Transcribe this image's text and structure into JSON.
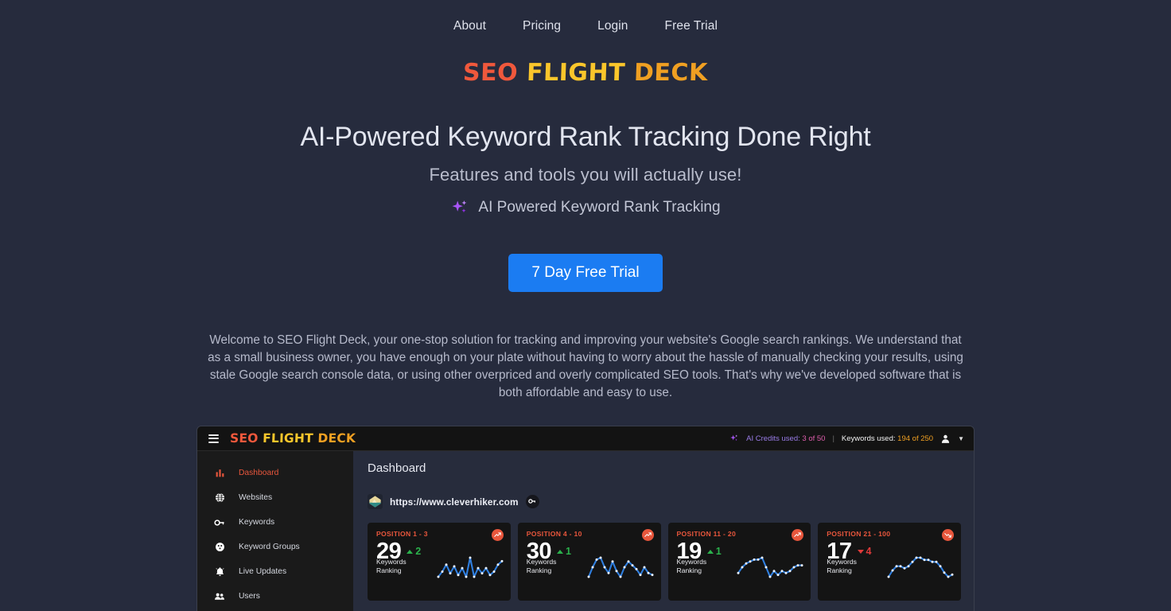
{
  "nav": {
    "items": [
      {
        "label": "About"
      },
      {
        "label": "Pricing"
      },
      {
        "label": "Login"
      },
      {
        "label": "Free Trial"
      }
    ]
  },
  "logo": {
    "part1": "SEO",
    "part2": "FLIGHT",
    "part3": "DECK",
    "color1": "#f0583c",
    "color2": "#fac62b",
    "color3": "#f0a022"
  },
  "hero": {
    "headline": "AI-Powered Keyword Rank Tracking Done Right",
    "subheadline": "Features and tools you will actually use!",
    "feature_line": "AI Powered Keyword Rank Tracking",
    "feature_icon": "sparkle-icon",
    "cta_label": "7 Day Free Trial",
    "cta_color": "#1b7cf2"
  },
  "intro": {
    "paragraph": "Welcome to SEO Flight Deck, your one-stop solution for tracking and improving your website's Google search rankings. We understand that as a small business owner, you have enough on your plate without having to worry about the hassle of manually checking your results, using stale Google search console data, or using other overpriced and overly complicated SEO tools. That's why we've developed software that is both affordable and easy to use."
  },
  "screenshot": {
    "topbar": {
      "menu_icon": "hamburger-icon",
      "logo_part1": "SEO",
      "logo_part2": "FLIGHT",
      "logo_part3": "DECK",
      "ai_icon": "sparkle-icon",
      "credits_label": "AI Credits used:",
      "credits_value": "3 of 50",
      "divider": "|",
      "keywords_label": "Keywords used:",
      "keywords_value": "194",
      "keywords_total": "of 250",
      "account_icon": "user-avatar-icon",
      "caret_icon": "chevron-down-icon"
    },
    "sidebar": {
      "items": [
        {
          "label": "Dashboard",
          "icon": "bar-chart-icon",
          "active": true
        },
        {
          "label": "Websites",
          "icon": "globe-icon",
          "active": false
        },
        {
          "label": "Keywords",
          "icon": "key-icon",
          "active": false
        },
        {
          "label": "Keyword Groups",
          "icon": "groups-icon",
          "active": false
        },
        {
          "label": "Live Updates",
          "icon": "bell-icon",
          "active": false
        },
        {
          "label": "Users",
          "icon": "users-icon",
          "active": false
        }
      ]
    },
    "main": {
      "page_title": "Dashboard",
      "site_url": "https://www.cleverhiker.com",
      "site_favicon": "mountain-favicon",
      "key_button_icon": "key-icon",
      "cards": [
        {
          "title": "POSITION 1 - 3",
          "value": "29",
          "delta": "2",
          "direction": "up",
          "sub_line1": "Keywords",
          "sub_line2": "Ranking",
          "badge_icon": "trend-up-icon",
          "sparkline": [
            14,
            11,
            7,
            12,
            8,
            13,
            9,
            14,
            3,
            14,
            9,
            12,
            9,
            13,
            11,
            7,
            5
          ]
        },
        {
          "title": "POSITION 4 - 10",
          "value": "30",
          "delta": "1",
          "direction": "up",
          "sub_line1": "Keywords",
          "sub_line2": "Ranking",
          "badge_icon": "trend-up-icon",
          "sparkline": [
            14,
            9,
            5,
            4,
            9,
            12,
            6,
            11,
            14,
            9,
            6,
            8,
            10,
            13,
            9,
            12,
            13
          ]
        },
        {
          "title": "POSITION 11 - 20",
          "value": "19",
          "delta": "1",
          "direction": "up",
          "sub_line1": "Keywords",
          "sub_line2": "Ranking",
          "badge_icon": "trend-up-icon",
          "sparkline": [
            12,
            9,
            7,
            6,
            5,
            5,
            4,
            9,
            14,
            11,
            13,
            11,
            12,
            11,
            9,
            8,
            8
          ]
        },
        {
          "title": "POSITION 21 - 100",
          "value": "17",
          "delta": "4",
          "direction": "down",
          "sub_line1": "Keywords",
          "sub_line2": "Ranking",
          "badge_icon": "trend-down-icon",
          "sparkline": [
            13,
            10,
            8,
            8,
            9,
            8,
            6,
            4,
            4,
            5,
            5,
            6,
            6,
            8,
            11,
            13,
            12
          ]
        }
      ]
    }
  }
}
